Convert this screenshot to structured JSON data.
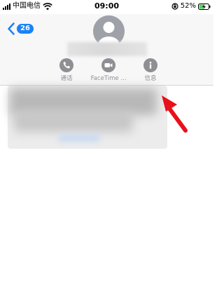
{
  "status_bar": {
    "carrier": "中国电信",
    "time": "09:00",
    "battery_percent": "52%",
    "battery_level": 0.52
  },
  "header": {
    "back_badge": "26",
    "back_icon": "chevron-left-icon",
    "avatar_icon": "person-icon"
  },
  "actions": [
    {
      "label": "通话",
      "icon": "phone-icon"
    },
    {
      "label": "FaceTime ...",
      "icon": "video-camera-icon"
    },
    {
      "label": "信息",
      "icon": "info-icon"
    }
  ],
  "colors": {
    "accent": "#1a82f7",
    "action_gray": "#8e8e93",
    "annotation_arrow": "#e8101a"
  }
}
